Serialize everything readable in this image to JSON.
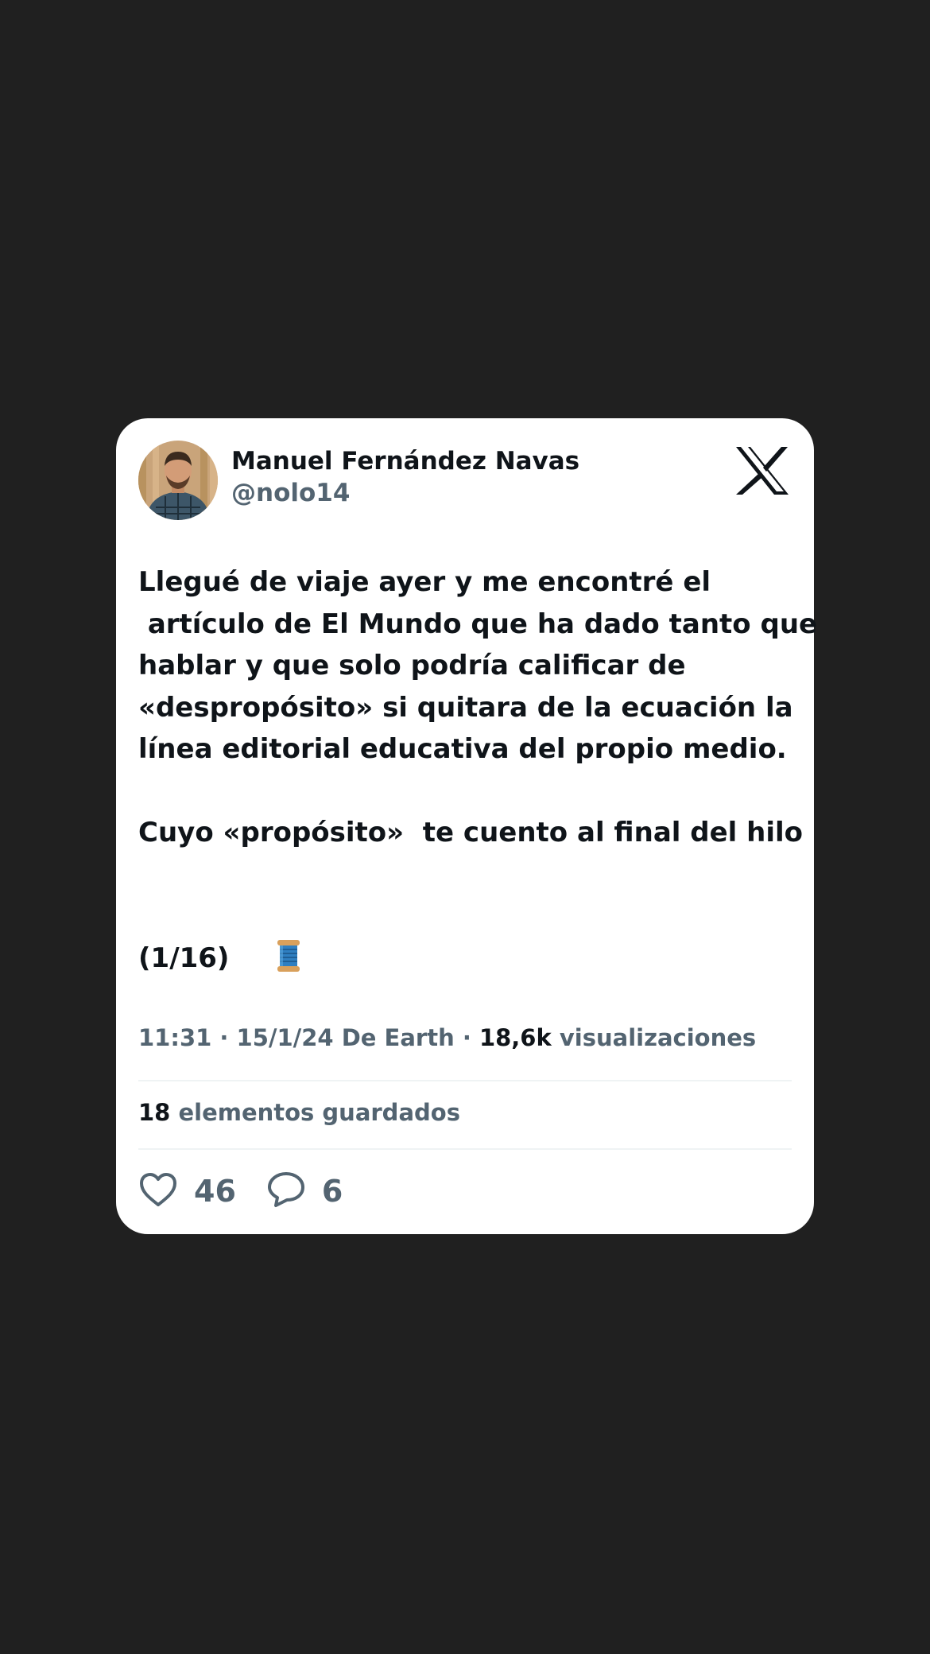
{
  "tweet": {
    "author_name": "Manuel Fernández Navas",
    "author_handle": "@nolo14",
    "lines": [
      "Llegué de viaje ayer y me encontré el",
      " artículo de El Mundo que ha dado tanto que",
      "hablar y que solo podría calificar de",
      "«despropósito» si quitara de la ecuación la",
      "línea editorial educativa del propio medio.",
      "",
      "Cuyo «propósito»  te cuento al final del hilo",
      "",
      "",
      "(1/16)"
    ],
    "emoji_name": "spool-of-thread-icon",
    "meta_prefix": "11:31 · 15/1/24 De Earth · ",
    "views_count": "18,6k",
    "views_label": " visualizaciones",
    "saved_count": "18",
    "saved_label": " elementos guardados",
    "likes_count": "46",
    "replies_count": "6"
  },
  "colors": {
    "background": "#202020",
    "card": "#ffffff",
    "text_primary": "#0f1419",
    "text_secondary": "#536471",
    "divider": "#eff3f4"
  },
  "icons": {
    "logo": "x-logo-icon",
    "like": "heart-icon",
    "reply": "speech-bubble-icon"
  }
}
